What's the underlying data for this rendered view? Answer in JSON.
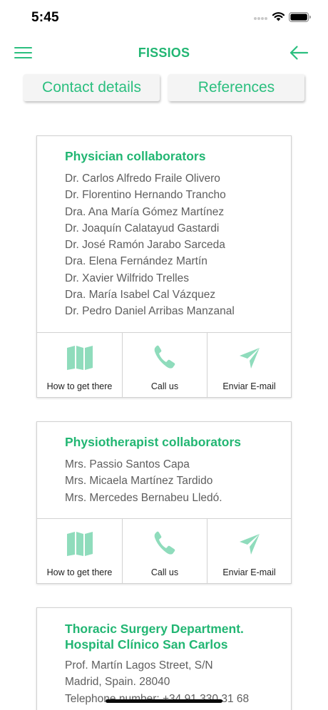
{
  "status_bar": {
    "time": "5:45"
  },
  "header": {
    "title": "FISSIOS",
    "menu_icon": "hamburger-menu-icon",
    "back_icon": "arrow-left-icon"
  },
  "tabs": [
    {
      "label": "Contact details"
    },
    {
      "label": "References"
    }
  ],
  "colors": {
    "accent": "#22b673",
    "icon_fill": "#8fdcbc"
  },
  "cards": [
    {
      "title": "Physician collaborators",
      "items": [
        "Dr. Carlos Alfredo Fraile Olivero",
        "Dr. Florentino Hernando Trancho",
        "Dra. Ana María Gómez Martínez",
        "Dr. Joaquín Calatayud Gastardi",
        "Dr. José Ramón Jarabo Sarceda",
        "Dra. Elena Fernández Martín",
        "Dr. Xavier Wilfrido Trelles",
        "Dra. María Isabel Cal Vázquez",
        "Dr. Pedro Daniel Arribas Manzanal"
      ],
      "actions": [
        {
          "label": "How to get there",
          "icon": "map-icon"
        },
        {
          "label": "Call us",
          "icon": "phone-icon"
        },
        {
          "label": "Enviar E-mail",
          "icon": "send-icon"
        }
      ]
    },
    {
      "title": "Physiotherapist collaborators",
      "items": [
        "Mrs. Passio Santos Capa",
        "Mrs. Micaela Martínez Tardido",
        "Mrs. Mercedes Bernabeu Lledó."
      ],
      "actions": [
        {
          "label": "How to get there",
          "icon": "map-icon"
        },
        {
          "label": "Call us",
          "icon": "phone-icon"
        },
        {
          "label": "Enviar E-mail",
          "icon": "send-icon"
        }
      ]
    },
    {
      "title_lines": [
        "Thoracic Surgery Department.",
        "Hospital Clínico San Carlos"
      ],
      "items": [
        "Prof. Martín Lagos Street, S/N",
        "Madrid, Spain. 28040",
        "Telephone number: +34 91 330 31 68"
      ]
    }
  ]
}
